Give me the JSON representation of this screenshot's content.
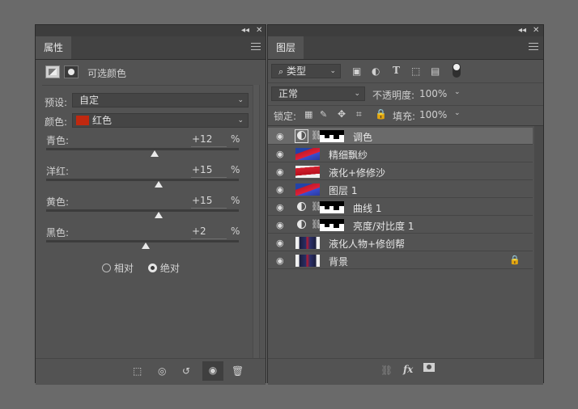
{
  "properties_panel": {
    "tab_label": "属性",
    "header_title": "可选颜色",
    "preset_label": "预设:",
    "preset_value": "自定",
    "colors_label": "颜色:",
    "colors_value": "红色",
    "colors_swatch": "#c0280f",
    "sliders": [
      {
        "label": "青色:",
        "value": "+12",
        "unit": "%",
        "level": 12
      },
      {
        "label": "洋红:",
        "value": "+15",
        "unit": "%",
        "level": 15
      },
      {
        "label": "黄色:",
        "value": "+15",
        "unit": "%",
        "level": 15
      },
      {
        "label": "黑色:",
        "value": "+2",
        "unit": "%",
        "level": 2
      }
    ],
    "method_relative": "相对",
    "method_absolute": "绝对",
    "method_selected": "绝对"
  },
  "layers_panel": {
    "tab_label": "图层",
    "filter_value": "类型",
    "blend_mode": "正常",
    "opacity_label": "不透明度:",
    "opacity_value": "100%",
    "lock_label": "锁定:",
    "fill_label": "填充:",
    "fill_value": "100%",
    "layers": [
      {
        "name": "调色",
        "kind": "adjustment",
        "selected": true
      },
      {
        "name": "精细飘纱",
        "kind": "pixel"
      },
      {
        "name": "液化+修修沙",
        "kind": "pixel"
      },
      {
        "name": "图层 1",
        "kind": "pixel"
      },
      {
        "name": "曲线 1",
        "kind": "adjustment"
      },
      {
        "name": "亮度/对比度 1",
        "kind": "adjustment"
      },
      {
        "name": "液化人物+修创帮",
        "kind": "pixel-figure"
      },
      {
        "name": "背景",
        "kind": "pixel-figure",
        "locked": true
      }
    ]
  }
}
